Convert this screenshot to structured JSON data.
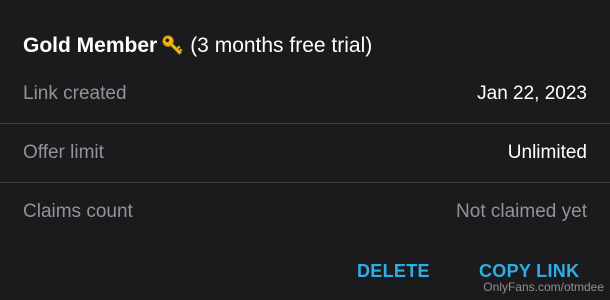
{
  "offer": {
    "name": "Gold Member",
    "icon": "key-icon",
    "note": " (3 months free trial)"
  },
  "details": [
    {
      "label": "Link created",
      "value": "Jan 22, 2023",
      "muted": false
    },
    {
      "label": "Offer limit",
      "value": "Unlimited",
      "muted": false
    },
    {
      "label": "Claims count",
      "value": "Not claimed yet",
      "muted": true
    }
  ],
  "actions": {
    "delete_label": "DELETE",
    "copy_label": "COPY LINK",
    "accent_color": "#2eaee8"
  },
  "watermark": "OnlyFans.com/otmdee"
}
